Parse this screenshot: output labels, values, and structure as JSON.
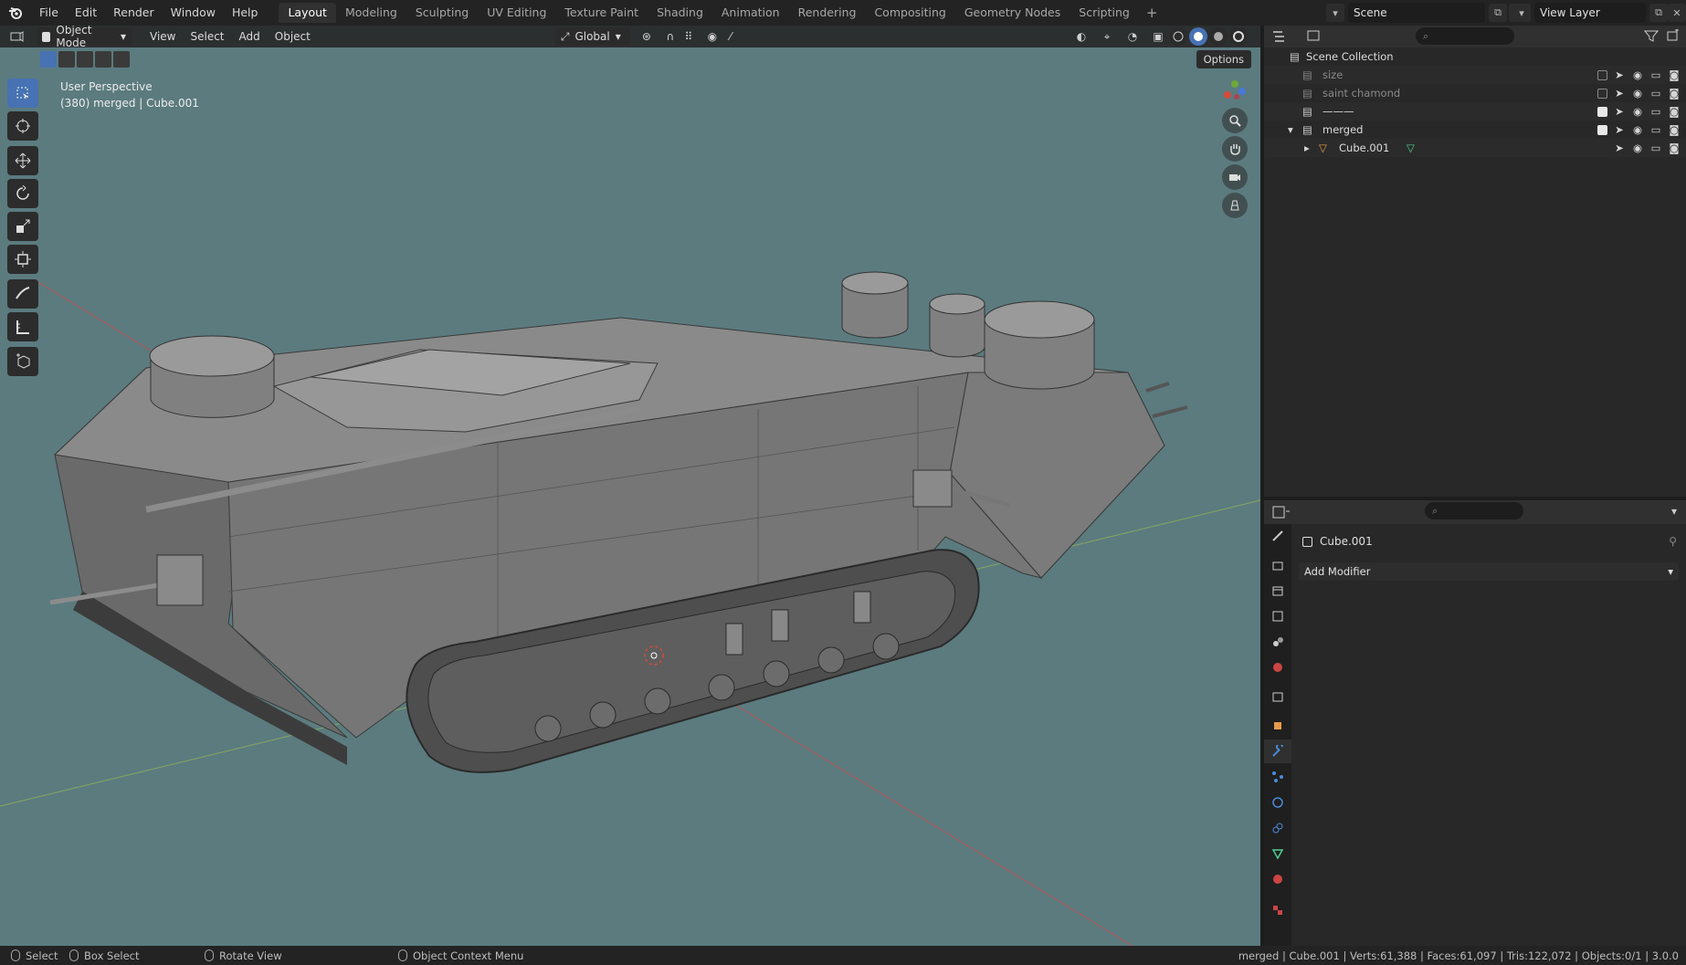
{
  "topbar": {
    "menus": [
      "File",
      "Edit",
      "Render",
      "Window",
      "Help"
    ],
    "workspaces": [
      "Layout",
      "Modeling",
      "Sculpting",
      "UV Editing",
      "Texture Paint",
      "Shading",
      "Animation",
      "Rendering",
      "Compositing",
      "Geometry Nodes",
      "Scripting"
    ],
    "active_workspace": "Layout",
    "add_tab": "+",
    "scene": "Scene",
    "view_layer": "View Layer"
  },
  "viewport": {
    "mode": "Object Mode",
    "menus": [
      "View",
      "Select",
      "Add",
      "Object"
    ],
    "orientation": "Global",
    "options": "Options",
    "perspective_label": "User Perspective",
    "object_label": "(380) merged | Cube.001",
    "background_color": "#5b7b7f"
  },
  "outliner": {
    "search_placeholder": "",
    "scene_collection": "Scene Collection",
    "rows": [
      {
        "label": "size",
        "dim": true,
        "checked": false
      },
      {
        "label": "saint chamond",
        "dim": true,
        "checked": false
      },
      {
        "label": "———",
        "dim": false,
        "checked": true
      },
      {
        "label": "merged",
        "dim": false,
        "checked": true
      },
      {
        "label": "Cube.001",
        "dim": false,
        "checked": null
      }
    ]
  },
  "properties": {
    "object_name": "Cube.001",
    "add_modifier": "Add Modifier"
  },
  "statusbar": {
    "select": "Select",
    "box_select": "Box Select",
    "rotate_view": "Rotate View",
    "context_menu": "Object Context Menu",
    "stats": "merged | Cube.001 | Verts:61,388 | Faces:61,097 | Tris:122,072 | Objects:0/1 | 3.0.0"
  }
}
